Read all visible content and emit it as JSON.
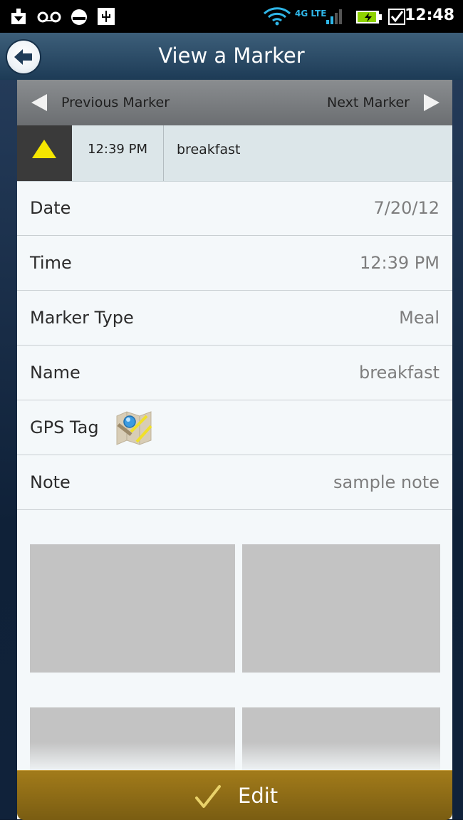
{
  "status_bar": {
    "time": "12:48",
    "network": "4G LTE",
    "icons": [
      "download-icon",
      "voicemail-icon",
      "android-icon",
      "usb-icon",
      "wifi-icon",
      "signal-icon",
      "battery-charging-icon",
      "checkbox-icon"
    ]
  },
  "header": {
    "title": "View a Marker"
  },
  "nav": {
    "previous_label": "Previous Marker",
    "next_label": "Next Marker"
  },
  "summary": {
    "time": "12:39 PM",
    "name": "breakfast"
  },
  "details": {
    "date": {
      "label": "Date",
      "value": "7/20/12"
    },
    "time": {
      "label": "Time",
      "value": "12:39 PM"
    },
    "marker_type": {
      "label": "Marker Type",
      "value": "Meal"
    },
    "name": {
      "label": "Name",
      "value": "breakfast"
    },
    "gps": {
      "label": "GPS Tag"
    },
    "note": {
      "label": "Note",
      "value": "sample note"
    }
  },
  "colors": {
    "accent_gold": "#8c6b16",
    "warning_yellow": "#f5e600",
    "title_blue": "#2c4d69"
  },
  "footer": {
    "edit_label": "Edit"
  }
}
